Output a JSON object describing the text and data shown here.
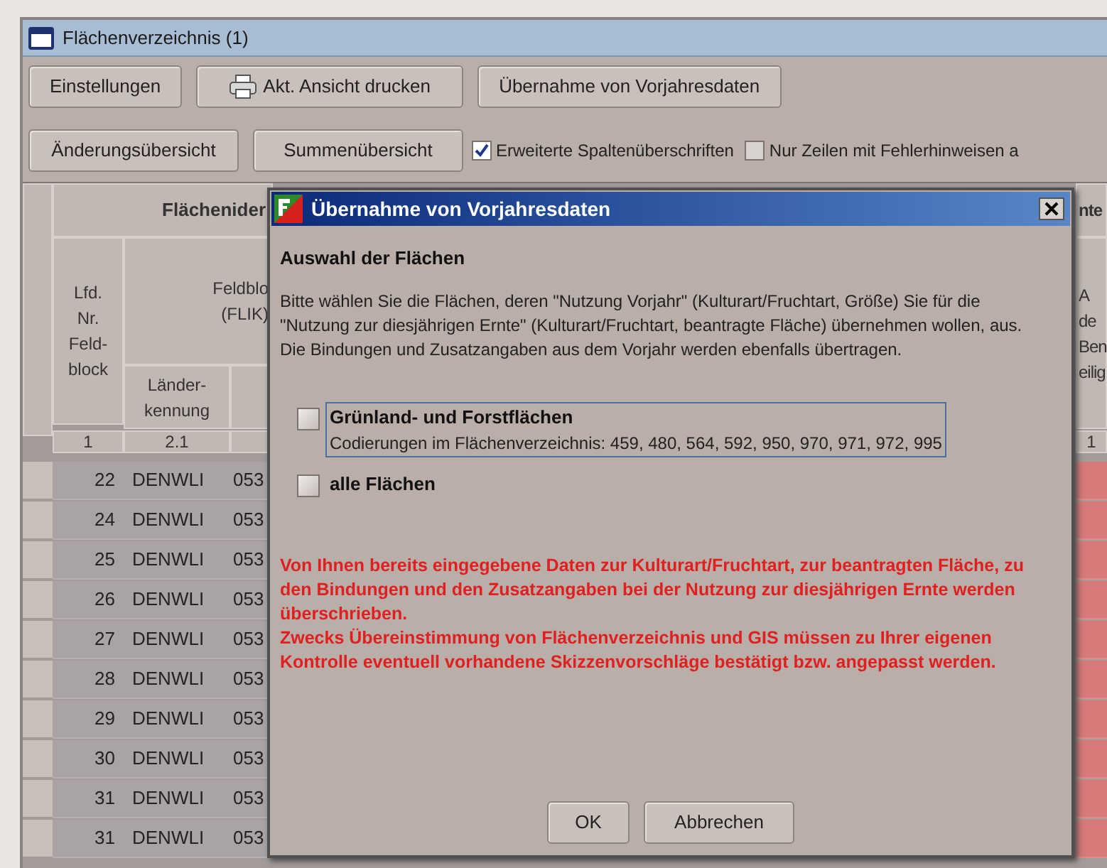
{
  "window": {
    "title": "Flächenverzeichnis (1)"
  },
  "toolbar_row_1": [
    {
      "label": "Einstellungen",
      "kind": "plain"
    },
    {
      "label": "Akt. Ansicht drucken",
      "kind": "print"
    },
    {
      "label": "Übernahme von Vorjahresdaten",
      "kind": "plain"
    }
  ],
  "toolbar_row_2": {
    "buttons": [
      "Änderungsübersicht",
      "Summenübersicht"
    ],
    "checkboxes": [
      {
        "label": "Erweiterte Spaltenüberschriften",
        "checked": true
      },
      {
        "label": "Nur Zeilen mit Fehlerhinweisen a",
        "checked": false
      }
    ]
  },
  "table": {
    "group_header": "Flächenider",
    "right_group_header": "nte",
    "lfd_header": [
      "Lfd.",
      "Nr.",
      "Feld-",
      "block"
    ],
    "feldblock_header": [
      "Feldblo",
      "(FLIK)"
    ],
    "laender_header": [
      "Länder-",
      "kennung"
    ],
    "right_header": [
      "A",
      "de",
      "Ben",
      "eilig"
    ],
    "column_numbers": [
      "1",
      "2.1"
    ],
    "right_column_number": "1",
    "rows": [
      {
        "nr": "22",
        "land": "DENWLI",
        "flik": "053"
      },
      {
        "nr": "24",
        "land": "DENWLI",
        "flik": "053"
      },
      {
        "nr": "25",
        "land": "DENWLI",
        "flik": "053"
      },
      {
        "nr": "26",
        "land": "DENWLI",
        "flik": "053"
      },
      {
        "nr": "27",
        "land": "DENWLI",
        "flik": "053"
      },
      {
        "nr": "28",
        "land": "DENWLI",
        "flik": "053"
      },
      {
        "nr": "29",
        "land": "DENWLI",
        "flik": "053"
      },
      {
        "nr": "30",
        "land": "DENWLI",
        "flik": "053"
      },
      {
        "nr": "31",
        "land": "DENWLI",
        "flik": "053"
      },
      {
        "nr": "31",
        "land": "DENWLI",
        "flik": "053"
      }
    ]
  },
  "dialog": {
    "title": "Übernahme von Vorjahresdaten",
    "heading": "Auswahl der Flächen",
    "intro": "Bitte wählen Sie die Flächen, deren \"Nutzung Vorjahr\" (Kulturart/Fruchtart, Größe) Sie für die \"Nutzung zur diesjährigen Ernte\" (Kulturart/Fruchtart, beantragte Fläche) übernehmen wollen, aus. Die Bindungen und Zusatzangaben aus dem Vorjahr werden ebenfalls übertragen.",
    "options": [
      {
        "label": "Grünland- und Forstflächen",
        "detail": "Codierungen im Flächenverzeichnis: 459, 480, 564, 592, 950, 970, 971, 972, 995",
        "checked": false,
        "focused": true
      },
      {
        "label": "alle Flächen",
        "checked": false,
        "focused": false
      }
    ],
    "warning": [
      "Von Ihnen bereits eingegebene Daten zur Kulturart/Fruchtart, zur beantragten Fläche, zu den Bindungen und den Zusatzangaben bei der Nutzung zur diesjährigen Ernte werden überschrieben.",
      "Zwecks Übereinstimmung von Flächenverzeichnis und GIS müssen zu Ihrer eigenen Kontrolle eventuell vorhandene Skizzenvorschläge bestätigt bzw. angepasst werden."
    ],
    "buttons": [
      "OK",
      "Abbrechen"
    ]
  }
}
